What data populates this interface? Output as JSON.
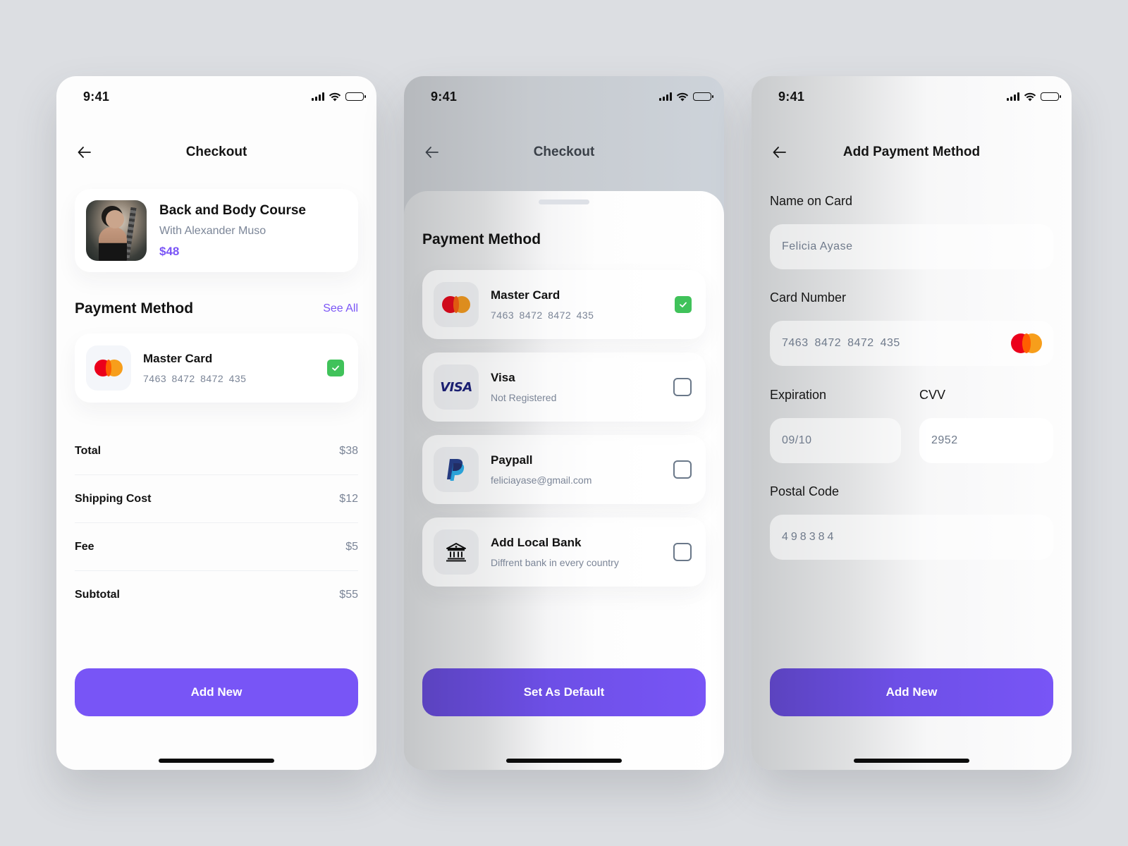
{
  "status_bar": {
    "time": "9:41"
  },
  "screens": [
    {
      "id": "checkout",
      "title": "Checkout",
      "course": {
        "title": "Back and Body Course",
        "author": "With Alexander Muso",
        "price": "$48"
      },
      "payment_section": {
        "title": "Payment Method",
        "see_all": "See All",
        "selected": {
          "name": "Master Card",
          "number": "7463 8472 8472 435",
          "icon": "mastercard-icon",
          "checked": true
        }
      },
      "summary": [
        {
          "label": "Total",
          "value": "$38"
        },
        {
          "label": "Shipping Cost",
          "value": "$12"
        },
        {
          "label": "Fee",
          "value": "$5"
        },
        {
          "label": "Subtotal",
          "value": "$55"
        }
      ],
      "cta": "Add New"
    },
    {
      "id": "payment-method-sheet",
      "title": "Checkout",
      "sheet_title": "Payment Method",
      "methods": [
        {
          "name": "Master Card",
          "sub": "7463 8472 8472 435",
          "icon": "mastercard-icon",
          "checked": true
        },
        {
          "name": "Visa",
          "sub": "Not Registered",
          "icon": "visa-icon",
          "icon_text": "VISA",
          "checked": false
        },
        {
          "name": "Paypall",
          "sub": "feliciayase@gmail.com",
          "icon": "paypal-icon",
          "checked": false
        },
        {
          "name": "Add Local Bank",
          "sub": "Diffrent bank in every country",
          "icon": "bank-icon",
          "checked": false
        }
      ],
      "cta": "Set As Default"
    },
    {
      "id": "add-payment-method",
      "title": "Add Payment Method",
      "fields": {
        "name": {
          "label": "Name on Card",
          "value": "Felicia Ayase"
        },
        "card_number": {
          "label": "Card Number",
          "value": "7463 8472 8472 435",
          "icon": "mastercard-icon"
        },
        "expiration": {
          "label": "Expiration",
          "value": "09/10"
        },
        "cvv": {
          "label": "CVV",
          "value": "2952"
        },
        "postal_code": {
          "label": "Postal Code",
          "value": "498384"
        }
      },
      "cta": "Add New"
    }
  ],
  "colors": {
    "accent": "#7855f6",
    "check_green": "#40c25a",
    "muted_text": "#7b8597",
    "mastercard_red": "#eb001b",
    "mastercard_orange": "#f79e1b",
    "visa_blue": "#1a1f71"
  }
}
